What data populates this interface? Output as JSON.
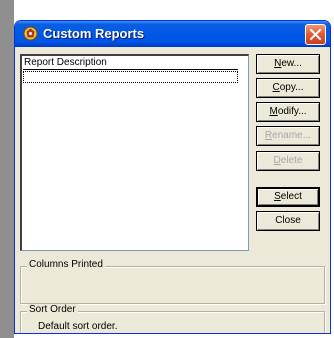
{
  "window": {
    "title": "Custom Reports"
  },
  "list": {
    "column_header": "Report Description",
    "items": []
  },
  "buttons": {
    "new": {
      "pre": "",
      "u": "N",
      "post": "ew..."
    },
    "copy": {
      "pre": "",
      "u": "C",
      "post": "opy..."
    },
    "modify": {
      "pre": "",
      "u": "M",
      "post": "odify..."
    },
    "rename": {
      "pre": "",
      "u": "R",
      "post": "ename..."
    },
    "delete": {
      "pre": "",
      "u": "D",
      "post": "elete"
    },
    "select": {
      "pre": "",
      "u": "S",
      "post": "elect"
    },
    "close": {
      "label": "Close"
    }
  },
  "columns_printed": {
    "label": "Columns Printed",
    "value": ""
  },
  "sort_order": {
    "label": "Sort Order",
    "value": "Default sort order."
  },
  "colors": {
    "title_bar": "#0058e6",
    "dialog_bg": "#ece9d8",
    "close_button": "#e05a35",
    "disabled_text": "#a7a6aa"
  }
}
